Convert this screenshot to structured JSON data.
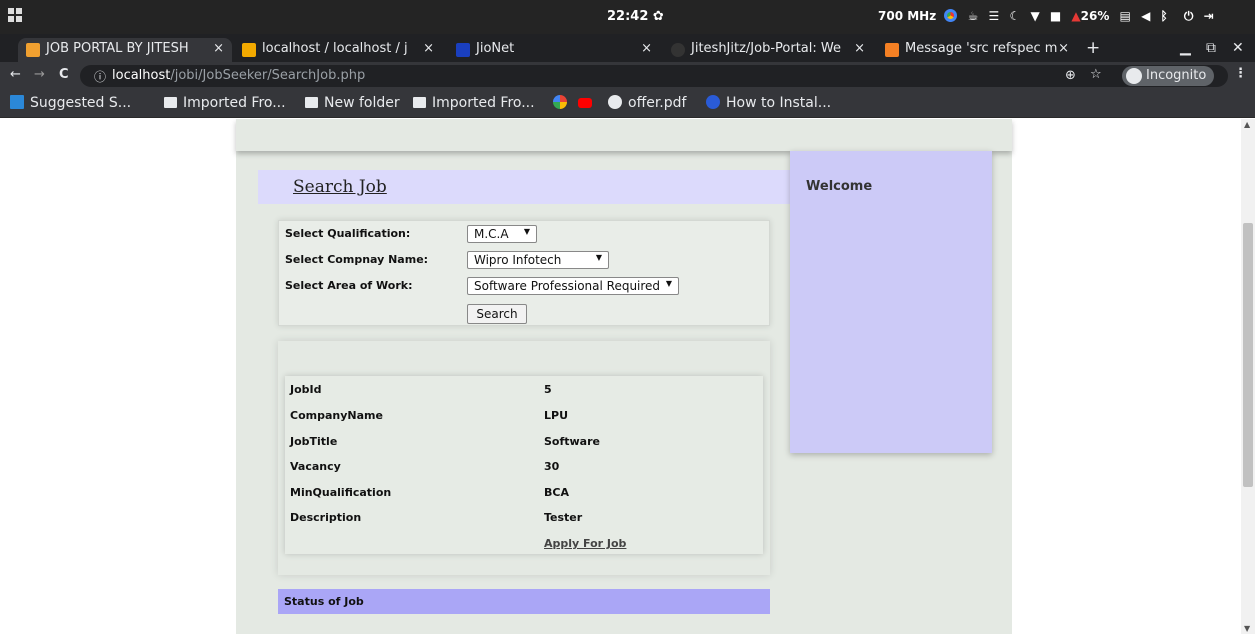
{
  "os": {
    "time": "22:42",
    "cpu": "700 MHz",
    "battery": "26%"
  },
  "tabs": [
    {
      "title": "JOB PORTAL BY JITESH",
      "close": "×",
      "favicon_color": "#f0a030"
    },
    {
      "title": "localhost / localhost / j",
      "close": "×",
      "favicon_color": "#f2a900"
    },
    {
      "title": "JioNet",
      "close": "×",
      "favicon_color": "#1a3fbf"
    },
    {
      "title": "JiteshJitz/Job-Portal: We",
      "close": "×",
      "favicon_color": "#333333"
    },
    {
      "title": "Message 'src refspec m",
      "close": "×",
      "favicon_color": "#f48024"
    }
  ],
  "toolbar": {
    "url_host": "localhost",
    "url_path": "/jobi/JobSeeker/SearchJob.php",
    "incognito_label": "Incognito"
  },
  "bookmarks": [
    {
      "label": "Suggested S...",
      "icon": "bing-icon"
    },
    {
      "label": "Imported Fro...",
      "icon": "folder-icon"
    },
    {
      "label": "New folder",
      "icon": "folder-icon"
    },
    {
      "label": "Imported Fro...",
      "icon": "folder-icon"
    },
    {
      "label": "",
      "icon": "google-icon"
    },
    {
      "label": "",
      "icon": "youtube-icon"
    },
    {
      "label": "offer.pdf",
      "icon": "globe-icon"
    },
    {
      "label": "How to Instal...",
      "icon": "site-icon"
    }
  ],
  "page": {
    "search_title": "Search Job",
    "sidebar_welcome": "Welcome",
    "form": {
      "qualification_label": "Select Qualification:",
      "qualification_value": "M.C.A",
      "company_label": "Select Compnay Name:",
      "company_value": "Wipro Infotech",
      "area_label": "Select Area of Work:",
      "area_value": "Software Professional Required",
      "search_button": "Search"
    },
    "result": {
      "rows": [
        {
          "label": "JobId",
          "value": "5"
        },
        {
          "label": "CompanyName",
          "value": "LPU"
        },
        {
          "label": "JobTitle",
          "value": "Software"
        },
        {
          "label": "Vacancy",
          "value": "30"
        },
        {
          "label": "MinQualification",
          "value": "BCA"
        },
        {
          "label": "Description",
          "value": "Tester"
        }
      ],
      "apply_link": "Apply For Job"
    },
    "status_title": "Status of Job"
  }
}
